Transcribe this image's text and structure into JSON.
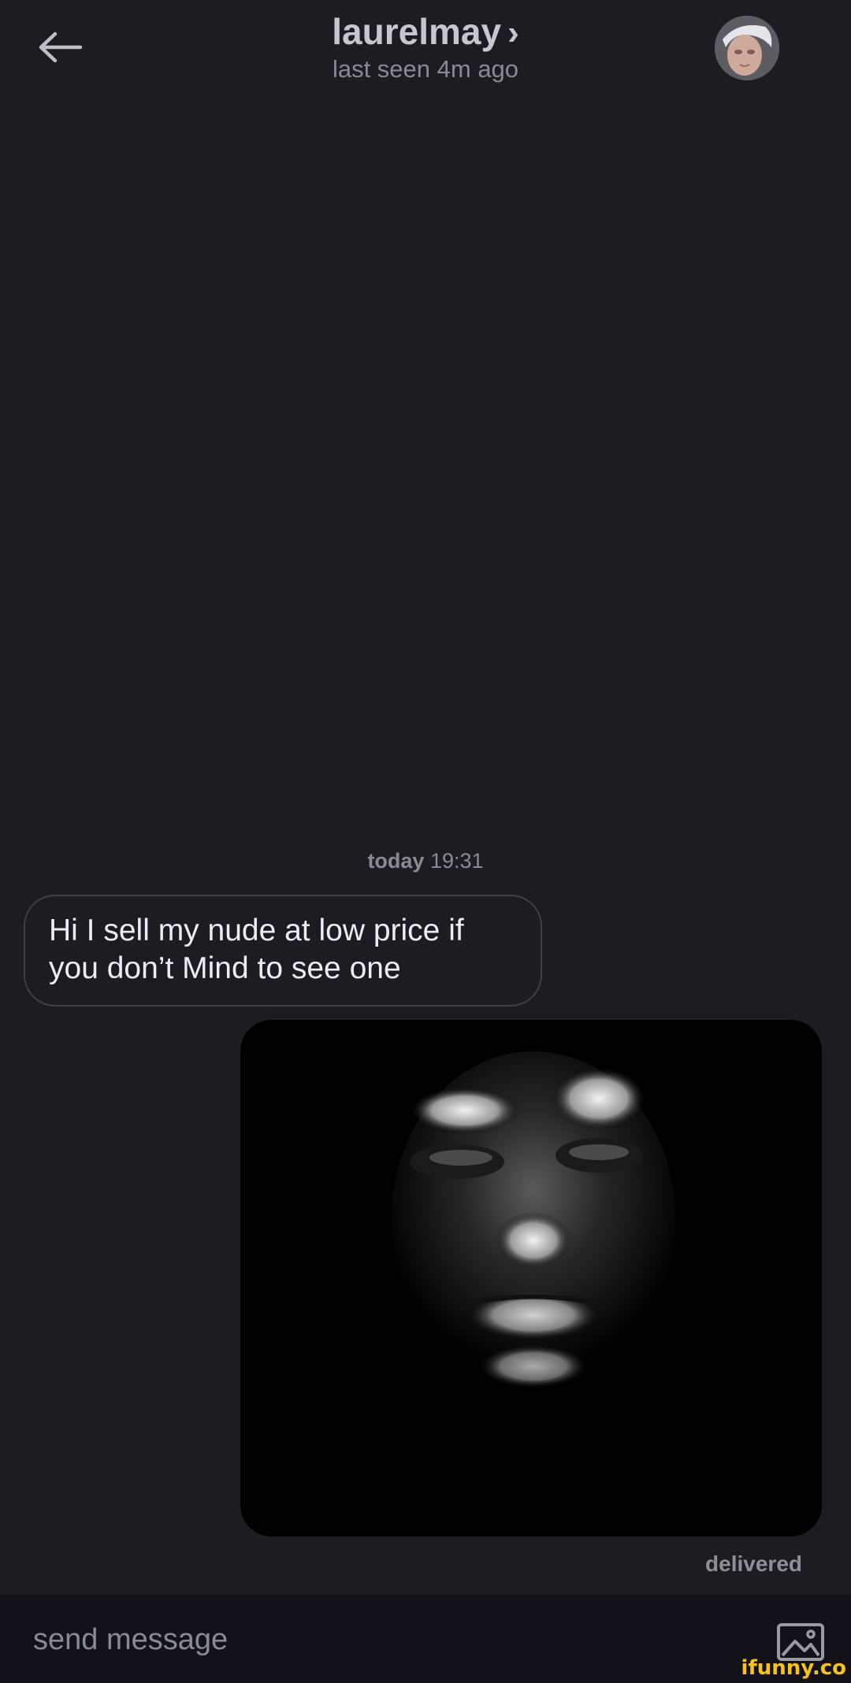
{
  "header": {
    "contact_name": "laurelmay",
    "chevron": "›",
    "status": "last seen 4m ago",
    "back_icon": "arrow-left-icon",
    "avatar_alt": "laurelmay"
  },
  "conversation": {
    "timestamp_day": "today",
    "timestamp_time": "19:31",
    "messages": [
      {
        "direction": "incoming",
        "type": "text",
        "text": "Hi I sell my nude at low price if you don’t Mind to see one"
      },
      {
        "direction": "outgoing",
        "type": "image",
        "status": "delivered"
      }
    ]
  },
  "composer": {
    "placeholder": "send message",
    "value": "",
    "attach_icon": "image-icon"
  },
  "watermark": "ifunny.co",
  "colors": {
    "background": "#1c1c21",
    "composer_bg": "#121218",
    "bubble_border": "#3f3f46",
    "muted_text": "#8a8a92",
    "watermark": "#f8c21d"
  }
}
